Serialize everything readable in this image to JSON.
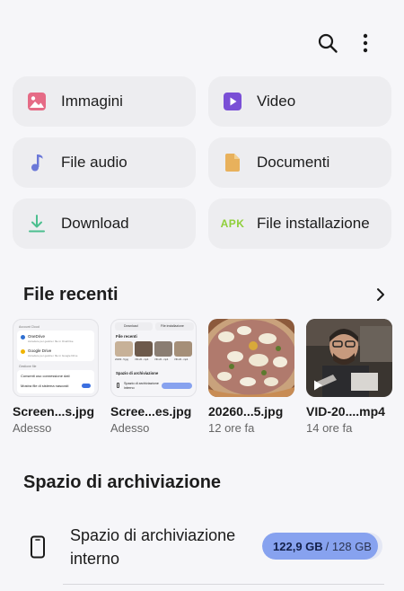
{
  "toolbar": {
    "search_icon": "search-icon",
    "more_icon": "more-vertical-icon"
  },
  "categories": [
    {
      "label": "Immagini",
      "icon": "image-icon",
      "color": "#e56b86"
    },
    {
      "label": "Video",
      "icon": "video-play-icon",
      "color": "#7a4fd6"
    },
    {
      "label": "File audio",
      "icon": "music-note-icon",
      "color": "#6b78d8"
    },
    {
      "label": "Documenti",
      "icon": "document-icon",
      "color": "#e8b15c"
    },
    {
      "label": "Download",
      "icon": "download-icon",
      "color": "#4cbf8f"
    },
    {
      "label": "File installazione",
      "icon": "apk-icon",
      "icon_text": "APK",
      "color": "#8fcf3a"
    }
  ],
  "recent": {
    "title": "File recenti",
    "files": [
      {
        "name": "Screen...s.jpg",
        "time": "Adesso"
      },
      {
        "name": "Scree...es.jpg",
        "time": "Adesso"
      },
      {
        "name": "20260...5.jpg",
        "time": "12 ore fa"
      },
      {
        "name": "VID-20....mp4",
        "time": "14 ore fa"
      }
    ],
    "thumb1": {
      "header": "Account Cloud",
      "onedrive": "OneDrive",
      "onedrive_sub": "Accedere per gestire i file in OneDrive",
      "gdrive": "Google Drive",
      "gdrive_sub": "Accedere per gestire i file in Google Drive",
      "section": "Gestione file",
      "row1": "Consenti uso connessione dati",
      "row2": "Mostra file di sistema nascosti"
    },
    "thumb2": {
      "tab1": "Download",
      "tab2": "File installazione",
      "header": "File recenti",
      "files": [
        "20260...5.jpg",
        "VID-20...mp4",
        "VID-20...mp4",
        "VID-20...mp4"
      ],
      "storage_title": "Spazio di archiviazione",
      "storage_row": "Spazio di archiviazione interno"
    }
  },
  "storage": {
    "title": "Spazio di archiviazione",
    "item_label": "Spazio di archiviazione interno",
    "used": "122,9 GB",
    "total": "/ 128 GB",
    "used_fraction": 0.96,
    "icon": "phone-icon"
  }
}
